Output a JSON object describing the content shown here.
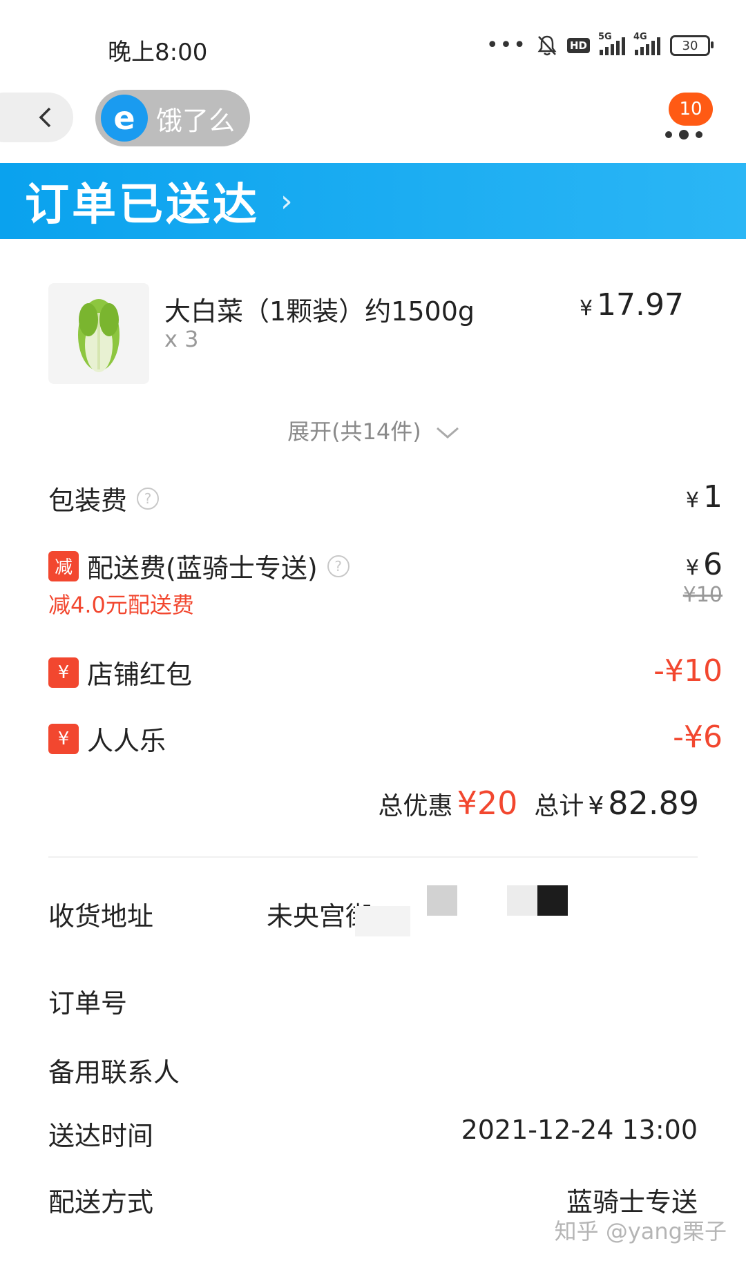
{
  "status_bar": {
    "time": "晚上8:00",
    "battery": "30",
    "hd": "HD",
    "net1": "5G",
    "net2": "4G"
  },
  "nav": {
    "brand_logo": "e",
    "brand_name": "饿了么",
    "badge": "10"
  },
  "banner": {
    "title": "订单已送达",
    "chevron": "›"
  },
  "order": {
    "item": {
      "name": "大白菜（1颗装）约1500g",
      "qty": "x 3",
      "price": "17.97",
      "currency": "¥"
    },
    "expand_label": "展开(共14件)",
    "packaging_fee": {
      "label": "包装费",
      "value": "1"
    },
    "delivery_fee": {
      "tag": "减",
      "label": "配送费(蓝骑士专送)",
      "value": "6",
      "original": "¥10",
      "discount_note": "减4.0元配送费"
    },
    "coupons": [
      {
        "tag": "¥",
        "label": "店铺红包",
        "value": "-¥10"
      },
      {
        "tag": "¥",
        "label": "人人乐",
        "value": "-¥6"
      }
    ],
    "totals": {
      "discount_label": "总优惠",
      "discount_value": "¥20",
      "total_label": "总计",
      "total_currency": "¥",
      "total_value": "82.89"
    }
  },
  "details": {
    "address_label": "收货地址",
    "address_value": "未央宫街",
    "order_no_label": "订单号",
    "backup_contact_label": "备用联系人",
    "delivery_time_label": "送达时间",
    "delivery_time_value": "2021-12-24 13:00",
    "delivery_method_label": "配送方式",
    "delivery_method_value": "蓝骑士专送"
  },
  "watermark": "知乎 @yang栗子",
  "colors": {
    "accent_blue": "#0aa2ee",
    "discount_red": "#f2472f",
    "badge_orange": "#ff5a14"
  }
}
